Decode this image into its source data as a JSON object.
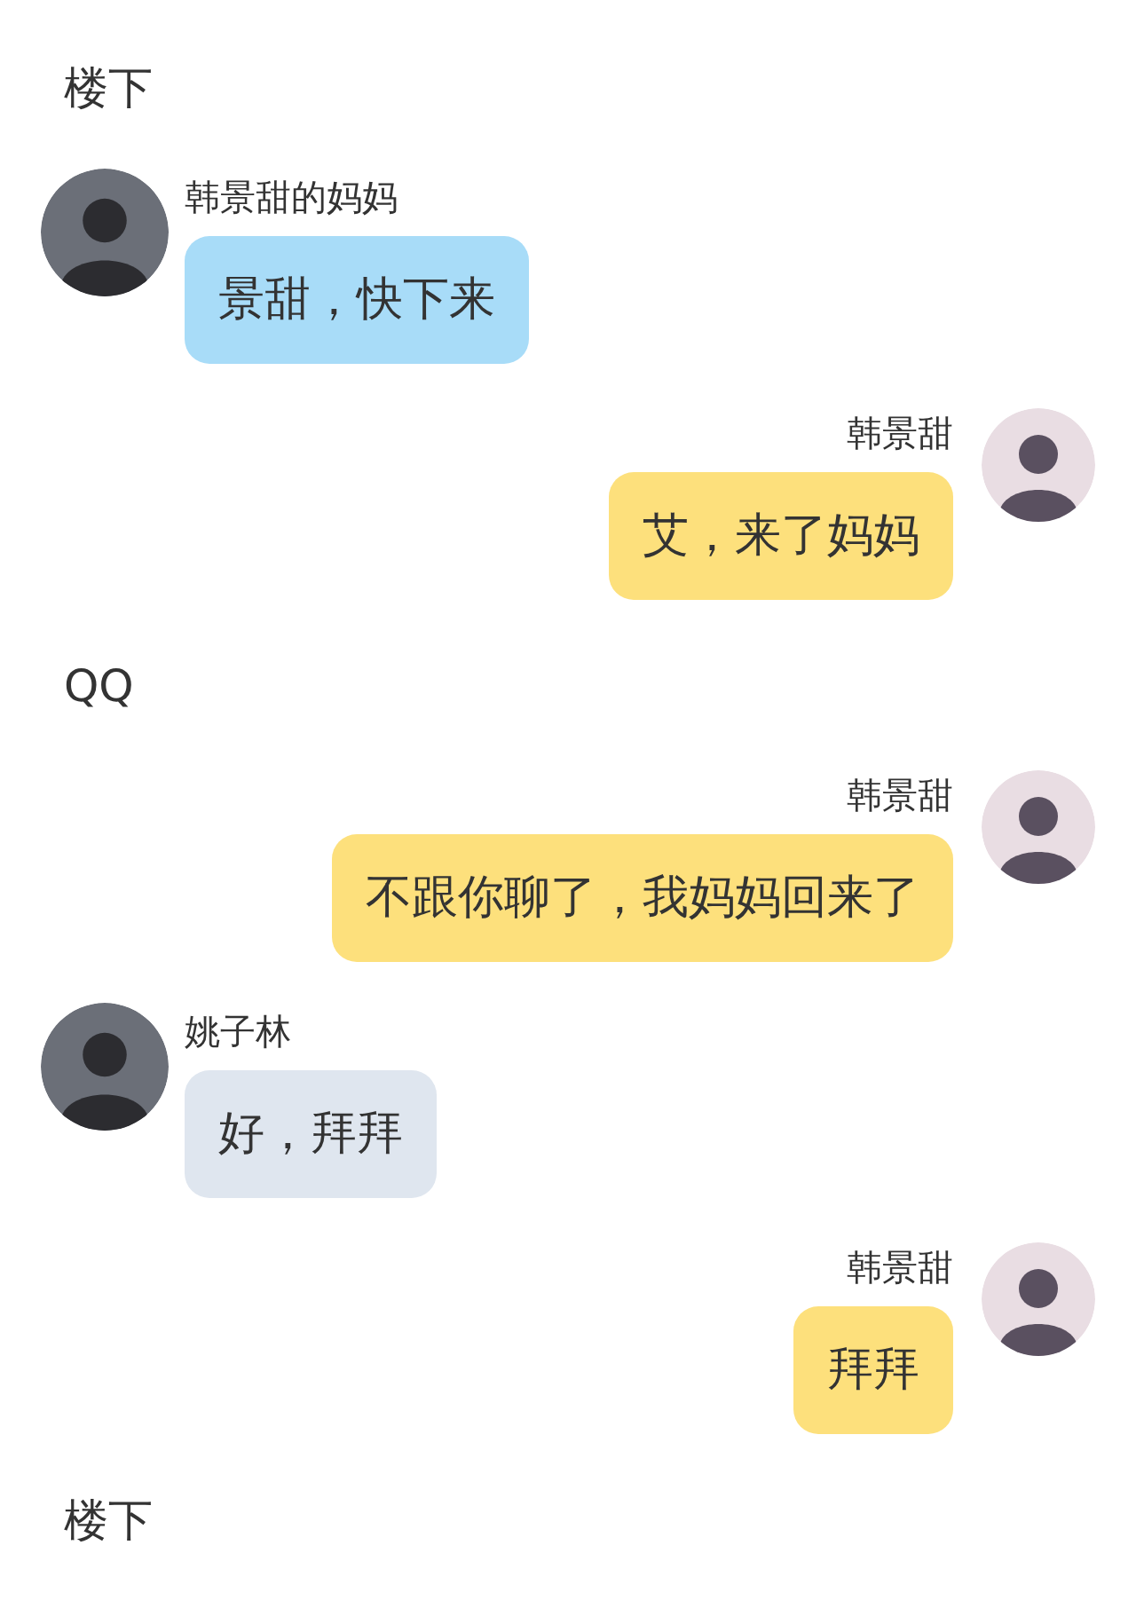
{
  "items": [
    {
      "kind": "scene",
      "text": "楼下"
    },
    {
      "kind": "incoming",
      "name": "韩景甜的妈妈",
      "text": "景甜，快下来",
      "color": "#a8dcf8"
    },
    {
      "kind": "outgoing",
      "name": "韩景甜",
      "text": "艾，来了妈妈",
      "color": "#fde07c"
    },
    {
      "kind": "scene",
      "text": "QQ"
    },
    {
      "kind": "outgoing",
      "name": "韩景甜",
      "text": "不跟你聊了，我妈妈回来了",
      "color": "#fde07c"
    },
    {
      "kind": "incoming",
      "name": "姚子林",
      "text": "好，拜拜",
      "color": "#dfe6ef"
    },
    {
      "kind": "outgoing",
      "name": "韩景甜",
      "text": "拜拜",
      "color": "#fde07c"
    },
    {
      "kind": "scene",
      "text": "楼下"
    }
  ]
}
